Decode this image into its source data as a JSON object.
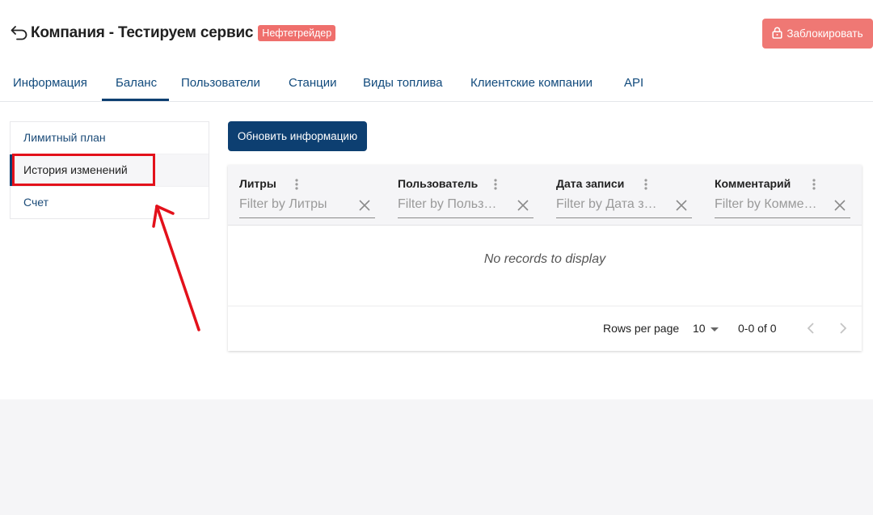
{
  "header": {
    "title": "Компания - Тестируем сервис",
    "badge": "Нефтетрейдер",
    "block_button": "Заблокировать"
  },
  "tabs": [
    {
      "label": "Информация"
    },
    {
      "label": "Баланс",
      "active": true
    },
    {
      "label": "Пользователи"
    },
    {
      "label": "Станции"
    },
    {
      "label": "Виды топлива"
    },
    {
      "label": "Клиентские компании"
    },
    {
      "label": "API"
    }
  ],
  "side_menu": [
    {
      "label": "Лимитный план"
    },
    {
      "label": "История изменений",
      "selected": true
    },
    {
      "label": "Счет"
    }
  ],
  "refresh_button": "Обновить информацию",
  "grid": {
    "columns": [
      {
        "title": "Литры",
        "filter_placeholder": "Filter by Литры"
      },
      {
        "title": "Пользователь",
        "filter_placeholder": "Filter by Польз…"
      },
      {
        "title": "Дата записи",
        "filter_placeholder": "Filter by Дата з…"
      },
      {
        "title": "Комментарий",
        "filter_placeholder": "Filter by Комме…"
      }
    ],
    "empty_text": "No records to display",
    "footer": {
      "rows_per_page_label": "Rows per page",
      "rows_per_page_value": "10",
      "page_info": "0-0 of 0"
    }
  },
  "colors": {
    "primary": "#0d3f71",
    "danger": "#ef7874",
    "badge": "#ef6f6c",
    "annotation": "#e3111b"
  }
}
